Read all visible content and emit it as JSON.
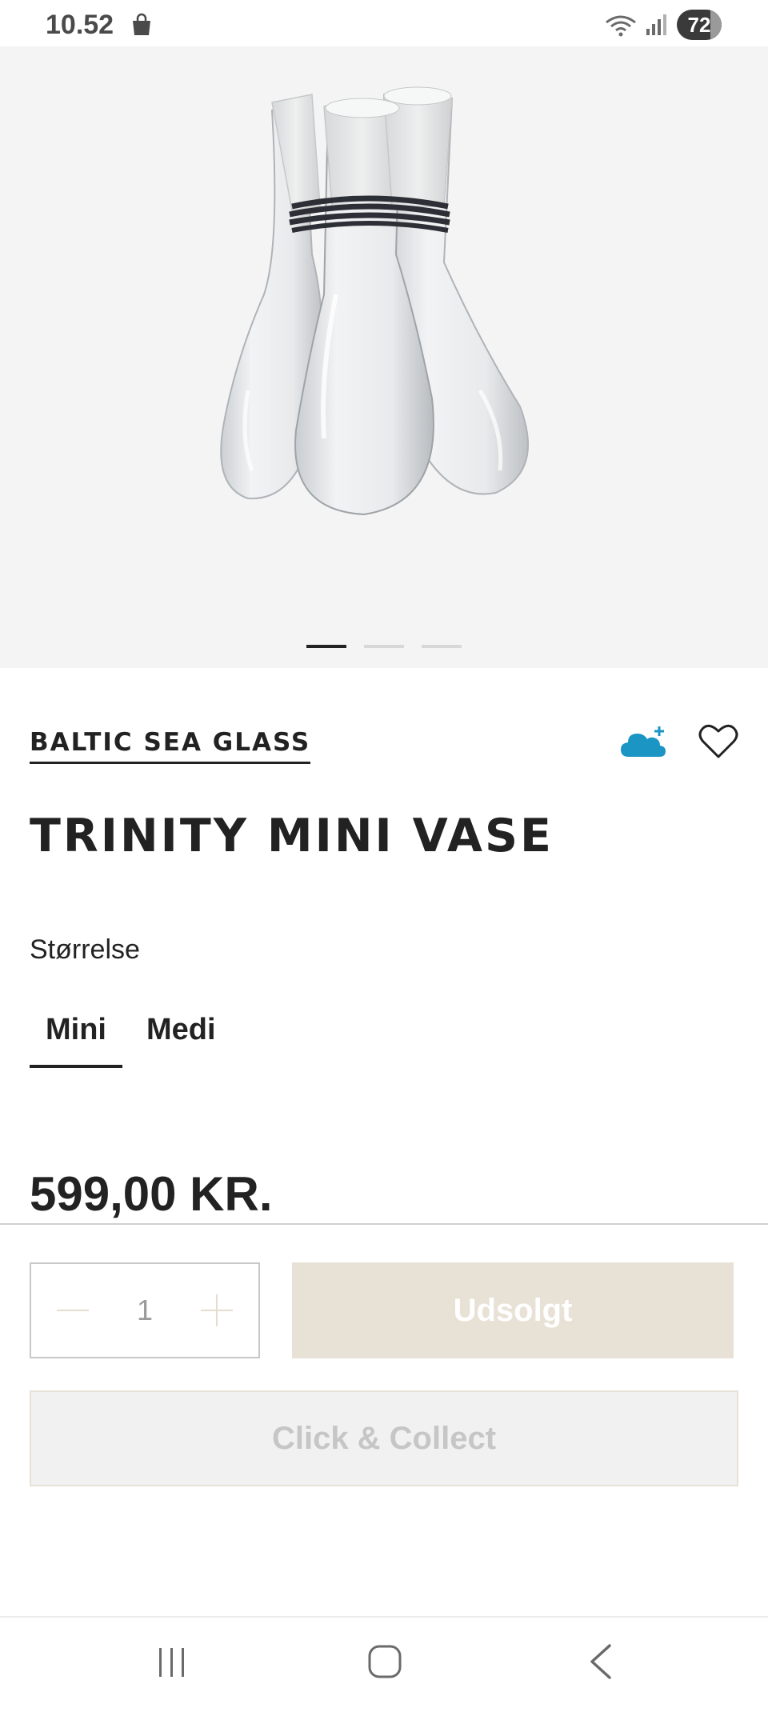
{
  "status_bar": {
    "time": "10.52",
    "battery": "72",
    "icons": [
      "shopping-bag-icon",
      "wifi-icon",
      "signal-icon"
    ]
  },
  "gallery": {
    "image_alt": "Trinity Mini Vase",
    "slides": 3,
    "active_slide": 1
  },
  "product": {
    "brand": "BALTIC SEA GLASS",
    "title": "TRINITY MINI VASE",
    "size_label": "Størrelse",
    "sizes": [
      "Mini",
      "Medi"
    ],
    "selected_size": "Mini",
    "price": "599,00 KR."
  },
  "purchase": {
    "quantity": "1",
    "soldout_label": "Udsolgt",
    "click_collect_label": "Click & Collect"
  },
  "colors": {
    "accent_cloud": "#1a95c4",
    "soldout_bg": "#e8e1d6",
    "text": "#222222"
  }
}
